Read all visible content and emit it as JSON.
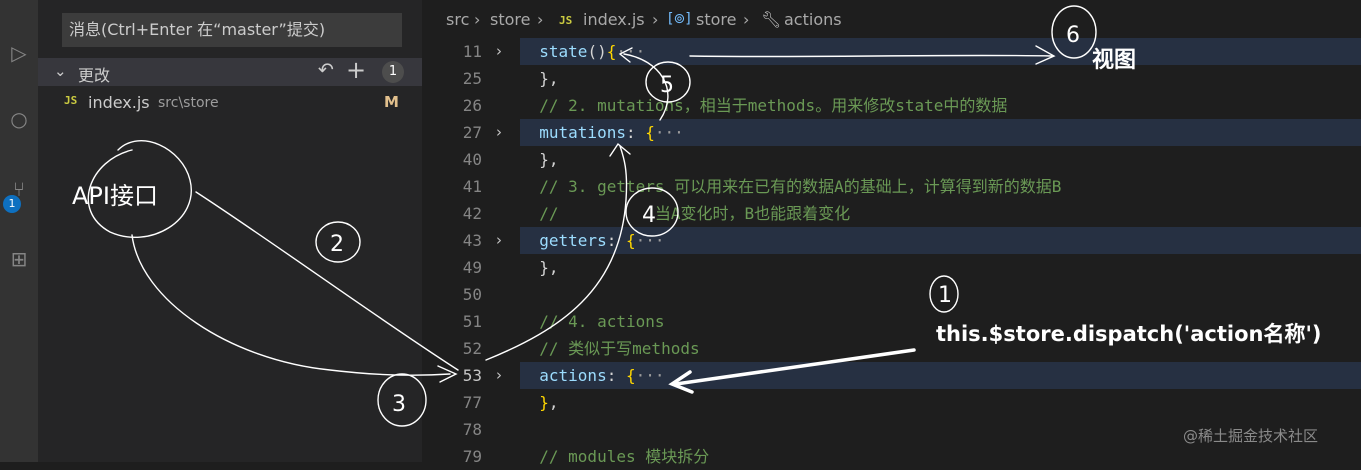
{
  "activity_bar": {
    "scm_badge": "1"
  },
  "sidebar": {
    "commit_message_placeholder": "消息(Ctrl+Enter 在“master”提交)",
    "changes_title": "更改",
    "changes_count": "1",
    "file": {
      "icon": "JS",
      "name": "index.js",
      "path": "src\\store",
      "status": "M"
    }
  },
  "breadcrumb": {
    "items": [
      "src",
      "store",
      "index.js",
      "store",
      "actions"
    ],
    "file_icon": "JS"
  },
  "editor": {
    "lines": [
      {
        "num": "11",
        "folded": true,
        "highlighted": true,
        "parts": [
          {
            "t": "  ",
            "c": "pn"
          },
          {
            "t": "state",
            "c": "fn"
          },
          {
            "t": "(",
            "c": "pn"
          },
          {
            "t": ")",
            "c": "pn"
          },
          {
            "t": "{",
            "c": "br"
          },
          {
            "t": "···",
            "c": "el"
          }
        ]
      },
      {
        "num": "25",
        "folded": false,
        "highlighted": false,
        "parts": [
          {
            "t": "  },",
            "c": "pn"
          }
        ]
      },
      {
        "num": "26",
        "folded": false,
        "highlighted": false,
        "parts": [
          {
            "t": "  // 2. mutations，相当于methods。用来修改state中的数据",
            "c": "cm"
          }
        ]
      },
      {
        "num": "27",
        "folded": true,
        "highlighted": true,
        "parts": [
          {
            "t": "  ",
            "c": "pn"
          },
          {
            "t": "mutations",
            "c": "fn"
          },
          {
            "t": ": ",
            "c": "pn"
          },
          {
            "t": "{",
            "c": "br"
          },
          {
            "t": "···",
            "c": "el"
          }
        ]
      },
      {
        "num": "40",
        "folded": false,
        "highlighted": false,
        "parts": [
          {
            "t": "  },",
            "c": "pn"
          }
        ]
      },
      {
        "num": "41",
        "folded": false,
        "highlighted": false,
        "parts": [
          {
            "t": "  // 3. getters 可以用来在已有的数据A的基础上，计算得到新的数据B",
            "c": "cm"
          }
        ]
      },
      {
        "num": "42",
        "folded": false,
        "highlighted": false,
        "parts": [
          {
            "t": "  //          当A变化时，B也能跟着变化",
            "c": "cm"
          }
        ]
      },
      {
        "num": "43",
        "folded": true,
        "highlighted": true,
        "parts": [
          {
            "t": "  ",
            "c": "pn"
          },
          {
            "t": "getters",
            "c": "fn"
          },
          {
            "t": ": ",
            "c": "pn"
          },
          {
            "t": "{",
            "c": "br"
          },
          {
            "t": "···",
            "c": "el"
          }
        ]
      },
      {
        "num": "49",
        "folded": false,
        "highlighted": false,
        "parts": [
          {
            "t": "  },",
            "c": "pn"
          }
        ]
      },
      {
        "num": "50",
        "folded": false,
        "highlighted": false,
        "parts": [
          {
            "t": "",
            "c": "pn"
          }
        ]
      },
      {
        "num": "51",
        "folded": false,
        "highlighted": false,
        "parts": [
          {
            "t": "  // 4. actions",
            "c": "cm"
          }
        ]
      },
      {
        "num": "52",
        "folded": false,
        "highlighted": false,
        "parts": [
          {
            "t": "  // 类似于写methods",
            "c": "cm"
          }
        ]
      },
      {
        "num": "53",
        "folded": true,
        "highlighted": true,
        "active": true,
        "parts": [
          {
            "t": "  ",
            "c": "pn"
          },
          {
            "t": "actions",
            "c": "fn"
          },
          {
            "t": ": ",
            "c": "pn"
          },
          {
            "t": "{",
            "c": "br"
          },
          {
            "t": "···",
            "c": "el"
          }
        ]
      },
      {
        "num": "77",
        "folded": false,
        "highlighted": false,
        "parts": [
          {
            "t": "  ",
            "c": "pn"
          },
          {
            "t": "}",
            "c": "br"
          },
          {
            "t": ",",
            "c": "pn"
          }
        ]
      },
      {
        "num": "78",
        "folded": false,
        "highlighted": false,
        "parts": [
          {
            "t": "",
            "c": "pn"
          }
        ]
      },
      {
        "num": "79",
        "folded": false,
        "highlighted": false,
        "parts": [
          {
            "t": "  // modules 模块拆分",
            "c": "cm"
          }
        ]
      }
    ]
  },
  "annotations": {
    "api_label": "API接口",
    "view_label": "视图",
    "dispatch_label": "this.$store.dispatch('action名称')",
    "step_numbers": [
      "1",
      "2",
      "3",
      "4",
      "5",
      "6"
    ]
  },
  "watermark": "@稀土掘金技术社区",
  "colors": {
    "editor_bg": "#1e1e1e",
    "sidebar_bg": "#252526",
    "activity_bg": "#333333",
    "comment": "#6a9955",
    "property": "#9cdcfe",
    "bracket": "#ffd700",
    "badge_blue": "#0e70c0",
    "modified": "#e2c08d",
    "js_icon": "#cbcb41"
  }
}
